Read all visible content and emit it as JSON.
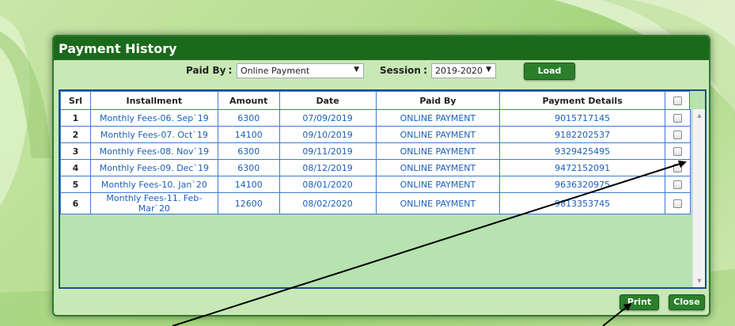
{
  "modal": {
    "title": "Payment History"
  },
  "filters": {
    "paid_by_label": "Paid By",
    "paid_by_value": "Online Payment",
    "session_label": "Session",
    "session_value": "2019-2020",
    "load_label": "Load"
  },
  "table": {
    "headers": [
      "Srl",
      "Installment",
      "Amount",
      "Date",
      "Paid By",
      "Payment Details"
    ],
    "rows": [
      {
        "srl": "1",
        "installment": "Monthly Fees-06. Sep`19",
        "amount": "6300",
        "date": "07/09/2019",
        "paid_by": "ONLINE PAYMENT",
        "details": "9015717145"
      },
      {
        "srl": "2",
        "installment": "Monthly Fees-07. Oct`19",
        "amount": "14100",
        "date": "09/10/2019",
        "paid_by": "ONLINE PAYMENT",
        "details": "9182202537"
      },
      {
        "srl": "3",
        "installment": "Monthly Fees-08. Nov`19",
        "amount": "6300",
        "date": "09/11/2019",
        "paid_by": "ONLINE PAYMENT",
        "details": "9329425495"
      },
      {
        "srl": "4",
        "installment": "Monthly Fees-09. Dec`19",
        "amount": "6300",
        "date": "08/12/2019",
        "paid_by": "ONLINE PAYMENT",
        "details": "9472152091"
      },
      {
        "srl": "5",
        "installment": "Monthly Fees-10. Jan`20",
        "amount": "14100",
        "date": "08/01/2020",
        "paid_by": "ONLINE PAYMENT",
        "details": "9636320975"
      },
      {
        "srl": "6",
        "installment": "Monthly Fees-11. Feb-Mar`20",
        "amount": "12600",
        "date": "08/02/2020",
        "paid_by": "ONLINE PAYMENT",
        "details": "9813353745"
      }
    ]
  },
  "footer": {
    "print_label": "Print",
    "close_label": "Close"
  },
  "colors": {
    "title_bar": "#1b6a1b",
    "button": "#2b7f2b",
    "table_border": "#3e7bd1",
    "cell_text": "#1c5fb8"
  }
}
